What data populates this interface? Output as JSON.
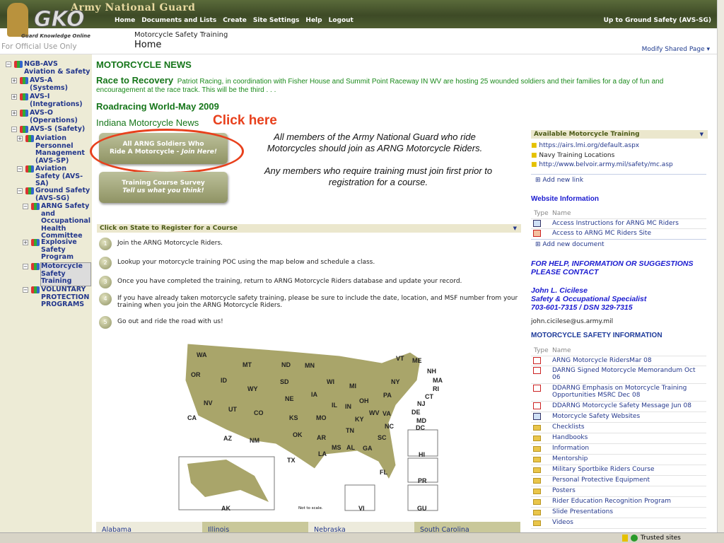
{
  "header": {
    "brand": "Army National Guard",
    "logo_text": "GKO",
    "logo_sub": "Guard Knowledge Online",
    "fouo": "For Official Use Only",
    "nav": [
      "Home",
      "Documents and Lists",
      "Create",
      "Site Settings",
      "Help",
      "Logout"
    ],
    "up_link": "Up to Ground Safety (AVS-SG)",
    "site_title": "Motorcycle Safety Training",
    "page_title": "Home",
    "modify": "Modify Shared Page ▾"
  },
  "sidebar": {
    "items": [
      {
        "label": "NGB-AVS Aviation & Safety",
        "toggle": "−"
      },
      {
        "label": "AVS-A (Systems)",
        "toggle": "+"
      },
      {
        "label": "AVS-I (Integrations)",
        "toggle": "+"
      },
      {
        "label": "AVS-O (Operations)",
        "toggle": "+"
      },
      {
        "label": "AVS-S (Safety)",
        "toggle": "−"
      },
      {
        "label": "Aviation Personnel Management (AVS-SP)",
        "toggle": "+"
      },
      {
        "label": "Aviation Safety (AVS-SA)",
        "toggle": "−"
      },
      {
        "label": "Ground Safety (AVS-SG)",
        "toggle": "−"
      },
      {
        "label": "ARNG Safety and Occupational Health Committee",
        "toggle": "−"
      },
      {
        "label": "Explosive Safety Program",
        "toggle": "+"
      },
      {
        "label": "Motorcycle Safety Training",
        "toggle": "−",
        "selected": true
      },
      {
        "label": "VOLUNTARY PROTECTION PROGRAMS",
        "toggle": "−"
      }
    ]
  },
  "news": {
    "heading": "MOTORCYCLE NEWS",
    "item1_title": "Race to Recovery",
    "item1_body": "Patriot Racing, in coordination with Fisher House and Summit Point Raceway IN WV are hosting 25 wounded soldiers and their families for a day of fun and encouragement at the race track. This will be the third . . .",
    "item2": "Roadracing World-May 2009",
    "item3": "Indiana Motorcycle News"
  },
  "annotation": "Click here",
  "buttons": {
    "join_line1": "All ARNG Soldiers Who",
    "join_line2": "Ride A Motorcycle - ",
    "join_em": "Join Here!",
    "survey_line1": "Training Course Survey",
    "survey_em": "Tell us what you think!"
  },
  "info": {
    "p1": "All members of the Army National Guard who ride Motorcycles should join as ARNG Motorcycle Riders.",
    "p2": "Any members who require training must join first prior to registration for a course."
  },
  "register": {
    "title": "Click on State to Register for a Course",
    "steps": [
      {
        "n": "1",
        "text": "Join the ARNG Motorcycle Riders."
      },
      {
        "n": "2",
        "text": "Lookup your motorcycle training POC using the map below and schedule a class."
      },
      {
        "n": "3",
        "text": "Once you have completed the training, return to ARNG Motorcycle Riders database and update your record."
      },
      {
        "n": "4",
        "text": "If you have already taken motorcycle safety training, please be sure to include the date, location, and MSF number from your training when you join the ARNG Motorcycle Riders."
      },
      {
        "n": "5",
        "text": "Go out and ride the road with us!"
      }
    ]
  },
  "map": {
    "states": [
      "WA",
      "OR",
      "CA",
      "ID",
      "NV",
      "MT",
      "WY",
      "UT",
      "AZ",
      "CO",
      "NM",
      "ND",
      "SD",
      "NE",
      "KS",
      "OK",
      "TX",
      "MN",
      "IA",
      "MO",
      "AR",
      "LA",
      "WI",
      "IL",
      "MI",
      "IN",
      "OH",
      "KY",
      "TN",
      "MS",
      "AL",
      "GA",
      "FL",
      "SC",
      "NC",
      "VA",
      "WV",
      "PA",
      "NY",
      "VT",
      "ME",
      "NH",
      "MA",
      "RI",
      "CT",
      "NJ",
      "DE",
      "MD",
      "DC",
      "AK",
      "HI",
      "PR",
      "VI",
      "GU"
    ],
    "note": "Not to scale."
  },
  "state_list": [
    "Alabama",
    "Illinois",
    "Nebraska",
    "South Carolina"
  ],
  "training": {
    "title": "Available Motorcycle Training",
    "links": [
      "https://airs.lmi.org/default.aspx",
      "Navy Training Locations",
      "http://www.belvoir.army.mil/safety/mc.asp"
    ],
    "add": "Add new link"
  },
  "website_info": {
    "title": "Website Information",
    "col_type": "Type",
    "col_name": "Name",
    "docs": [
      "Access Instructions for ARNG MC Riders",
      "Access to ARNG MC Riders Site"
    ],
    "add": "Add new document"
  },
  "contact": {
    "heading": "FOR HELP, INFORMATION OR SUGGESTIONS PLEASE CONTACT",
    "name": "John L. Cicilese",
    "role": "Safety & Occupational Specialist",
    "phone": "703-601-7315 / DSN 329-7315",
    "email": "john.cicilese@us.army.mil"
  },
  "safety_info": {
    "title": "MOTORCYCLE SAFETY INFORMATION",
    "col_type": "Type",
    "col_name": "Name",
    "items": [
      {
        "type": "pdf",
        "name": "ARNG Motorcycle RidersMar 08"
      },
      {
        "type": "pdf",
        "name": "DARNG Signed Motorcycle Memorandum Oct 06"
      },
      {
        "type": "pdf",
        "name": "DDARNG Emphasis on Motorcycle Training Opportunities MSRC Dec 08"
      },
      {
        "type": "pdf",
        "name": "DDARNG Motorcycle Safety Message Jun 08"
      },
      {
        "type": "web",
        "name": "Motorcycle Safety Websites"
      },
      {
        "type": "folder",
        "name": "Checklists"
      },
      {
        "type": "folder",
        "name": "Handbooks"
      },
      {
        "type": "folder",
        "name": "Information"
      },
      {
        "type": "folder",
        "name": "Mentorship"
      },
      {
        "type": "folder",
        "name": "Military Sportbike Riders Course"
      },
      {
        "type": "folder",
        "name": "Personal Protective Equipment"
      },
      {
        "type": "folder",
        "name": "Posters"
      },
      {
        "type": "folder",
        "name": "Rider Education Recognition Program"
      },
      {
        "type": "folder",
        "name": "Slide Presentations"
      },
      {
        "type": "folder",
        "name": "Videos"
      }
    ]
  },
  "status": {
    "zone": "Trusted sites"
  }
}
